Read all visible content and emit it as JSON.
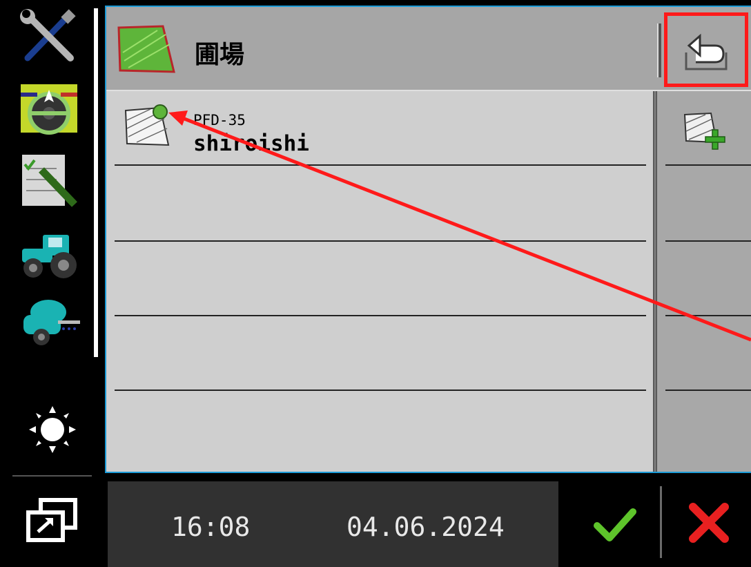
{
  "header": {
    "title": "圃場"
  },
  "fields": [
    {
      "code": "PFD-35",
      "name": "shiroishi"
    }
  ],
  "footer": {
    "time": "16:08",
    "date": "04.06.2024"
  },
  "colors": {
    "panel_border": "#1a9ad6",
    "highlight": "#ff1a1a",
    "ok": "#5ec42b",
    "cancel": "#e82020",
    "field_icon": "#5eb53a"
  },
  "icons": {
    "sidebar": [
      "tools-icon",
      "guidance-steering-icon",
      "task-checklist-icon",
      "tractor-icon",
      "sprayer-implement-icon",
      "brightness-icon",
      "window-switch-icon"
    ],
    "header": [
      "field-icon",
      "back-icon"
    ],
    "right_column": [
      "add-field-icon"
    ],
    "footer": [
      "checkmark-icon",
      "cancel-x-icon"
    ]
  }
}
